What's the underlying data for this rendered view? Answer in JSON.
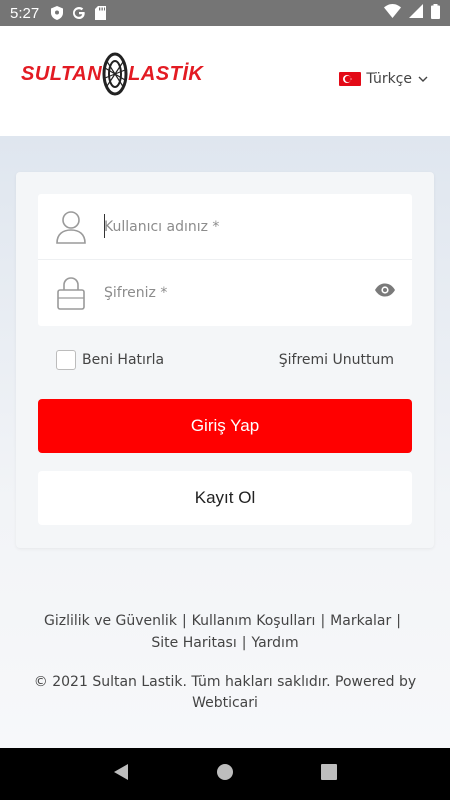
{
  "status_bar": {
    "time": "5:27",
    "icons_left": [
      "shield-icon",
      "google-g-icon",
      "sd-card-icon"
    ],
    "icons_right": [
      "wifi-icon",
      "signal-icon",
      "battery-icon"
    ]
  },
  "header": {
    "logo_text_left": "SULTAN",
    "logo_text_right": "LASTİK",
    "language": "Türkçe",
    "brand_color": "#e31b23"
  },
  "login_form": {
    "username_placeholder": "Kullanıcı adınız *",
    "password_placeholder": "Şifreniz *",
    "remember_label": "Beni Hatırla",
    "forgot_link": "Şifremi Unuttum",
    "login_button": "Giriş Yap",
    "register_button": "Kayıt Ol",
    "accent_color": "#ff0000"
  },
  "footer": {
    "links": [
      "Gizlilik ve Güvenlik",
      "Kullanım Koşulları",
      "Markalar",
      "Site Haritası",
      "Yardım"
    ],
    "separator": "|",
    "copyright": "© 2021 Sultan Lastik. Tüm hakları saklıdır. Powered by Webticari"
  },
  "nav_bar": {
    "icons": [
      "back-icon",
      "home-icon",
      "recents-icon"
    ]
  }
}
